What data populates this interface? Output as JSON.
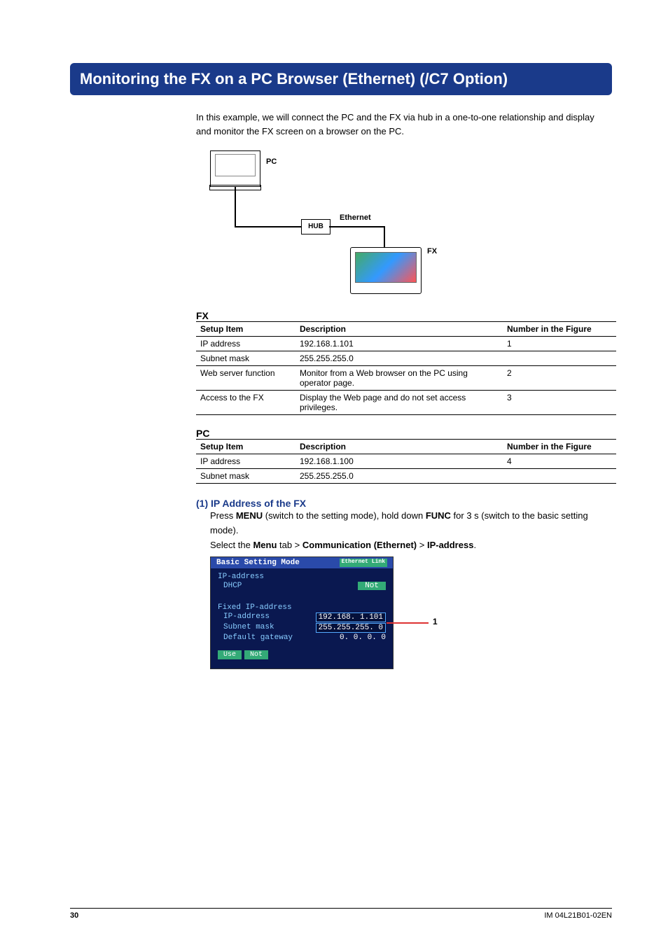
{
  "title": "Monitoring the FX on a PC Browser (Ethernet) (/C7 Option)",
  "intro": "In this example, we will connect the PC and the FX via hub in a one-to-one relationship and display and monitor the FX screen on a browser on the PC.",
  "diagram": {
    "pc_label": "PC",
    "hub_label": "HUB",
    "eth_label": "Ethernet",
    "fx_label": "FX"
  },
  "fx_section": {
    "heading": "FX",
    "columns": [
      "Setup Item",
      "Description",
      "Number in the Figure"
    ],
    "rows": [
      {
        "item": "IP address",
        "desc": "192.168.1.101",
        "num": "1"
      },
      {
        "item": "Subnet mask",
        "desc": "255.255.255.0",
        "num": ""
      },
      {
        "item": "Web server function",
        "desc": "Monitor from a Web browser on the PC using operator page.",
        "num": "2"
      },
      {
        "item": "Access to the FX",
        "desc": "Display the Web page and do not set access privileges.",
        "num": "3"
      }
    ]
  },
  "pc_section": {
    "heading": "PC",
    "columns": [
      "Setup Item",
      "Description",
      "Number in the Figure"
    ],
    "rows": [
      {
        "item": "IP address",
        "desc": "192.168.1.100",
        "num": "4"
      },
      {
        "item": "Subnet mask",
        "desc": "255.255.255.0",
        "num": ""
      }
    ]
  },
  "step1": {
    "heading": "(1) IP Address of the FX",
    "line1_pre": "Press ",
    "line1_b1": "MENU",
    "line1_mid": " (switch to the setting mode), hold down ",
    "line1_b2": "FUNC",
    "line1_post": " for 3 s (switch to the basic setting mode).",
    "line2_pre": "Select the ",
    "line2_b1": "Menu",
    "line2_mid1": " tab > ",
    "line2_b2": "Communication (Ethernet)",
    "line2_mid2": " > ",
    "line2_b3": "IP-address",
    "line2_post": "."
  },
  "settings": {
    "title": "Basic Setting Mode",
    "badge": "Ethernet Link",
    "ip_label": "IP-address",
    "dhcp_label": "DHCP",
    "dhcp_value": "Not",
    "fixed_label": "Fixed IP-address",
    "ip_row_label": "IP-address",
    "ip_row_value": "192.168.  1.101",
    "mask_row_label": "Subnet mask",
    "mask_row_value": "255.255.255.  0",
    "gw_row_label": "Default gateway",
    "gw_row_value": "  0.  0.  0.  0",
    "btn_use": "Use",
    "btn_not": "Not",
    "callout": "1"
  },
  "footer": {
    "page": "30",
    "doc": "IM 04L21B01-02EN"
  }
}
